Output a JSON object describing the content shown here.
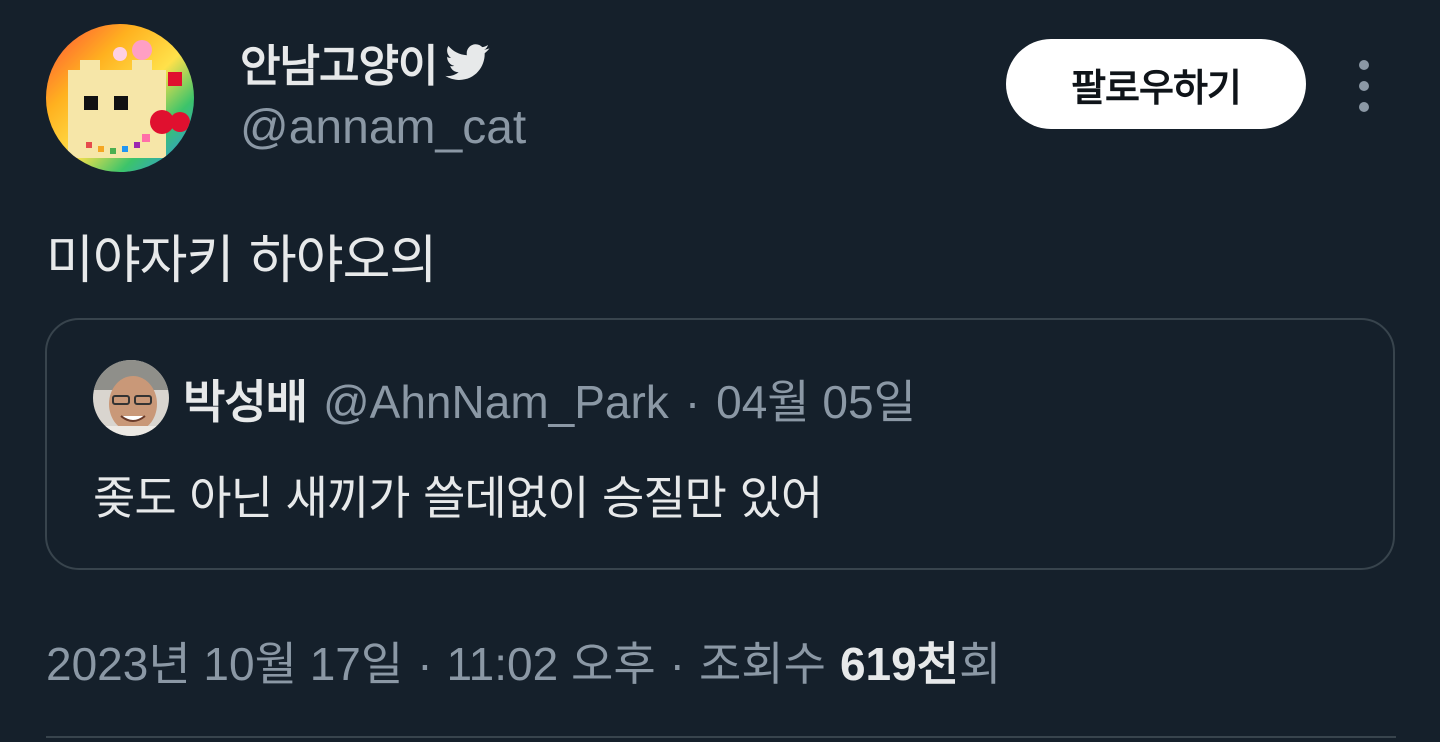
{
  "author": {
    "display_name": "안남고양이",
    "handle": "@annam_cat",
    "avatar_icon": "pixel-art-cat-avatar",
    "badge_icon": "twitter-bird-icon"
  },
  "actions": {
    "follow_label": "팔로우하기",
    "more_icon": "more-vertical-icon"
  },
  "tweet": {
    "text": "미야자키 하야오의"
  },
  "quoted_tweet": {
    "display_name": "박성배",
    "handle": "@AhnNam_Park",
    "separator": "·",
    "date": "04월 05일",
    "text": "좆도 아닌 새끼가 쓸데없이 승질만 있어",
    "avatar_icon": "user-photo-avatar"
  },
  "meta": {
    "date": "2023년 10월 17일",
    "separator": "·",
    "time": "11:02 오후",
    "views_label": "조회수",
    "views_count": "619천",
    "views_suffix": "회"
  },
  "colors": {
    "background": "#15202b",
    "primary_text": "#e7e9ea",
    "secondary_text": "#8b98a5",
    "border": "#38444d",
    "follow_button_bg": "#ffffff"
  }
}
